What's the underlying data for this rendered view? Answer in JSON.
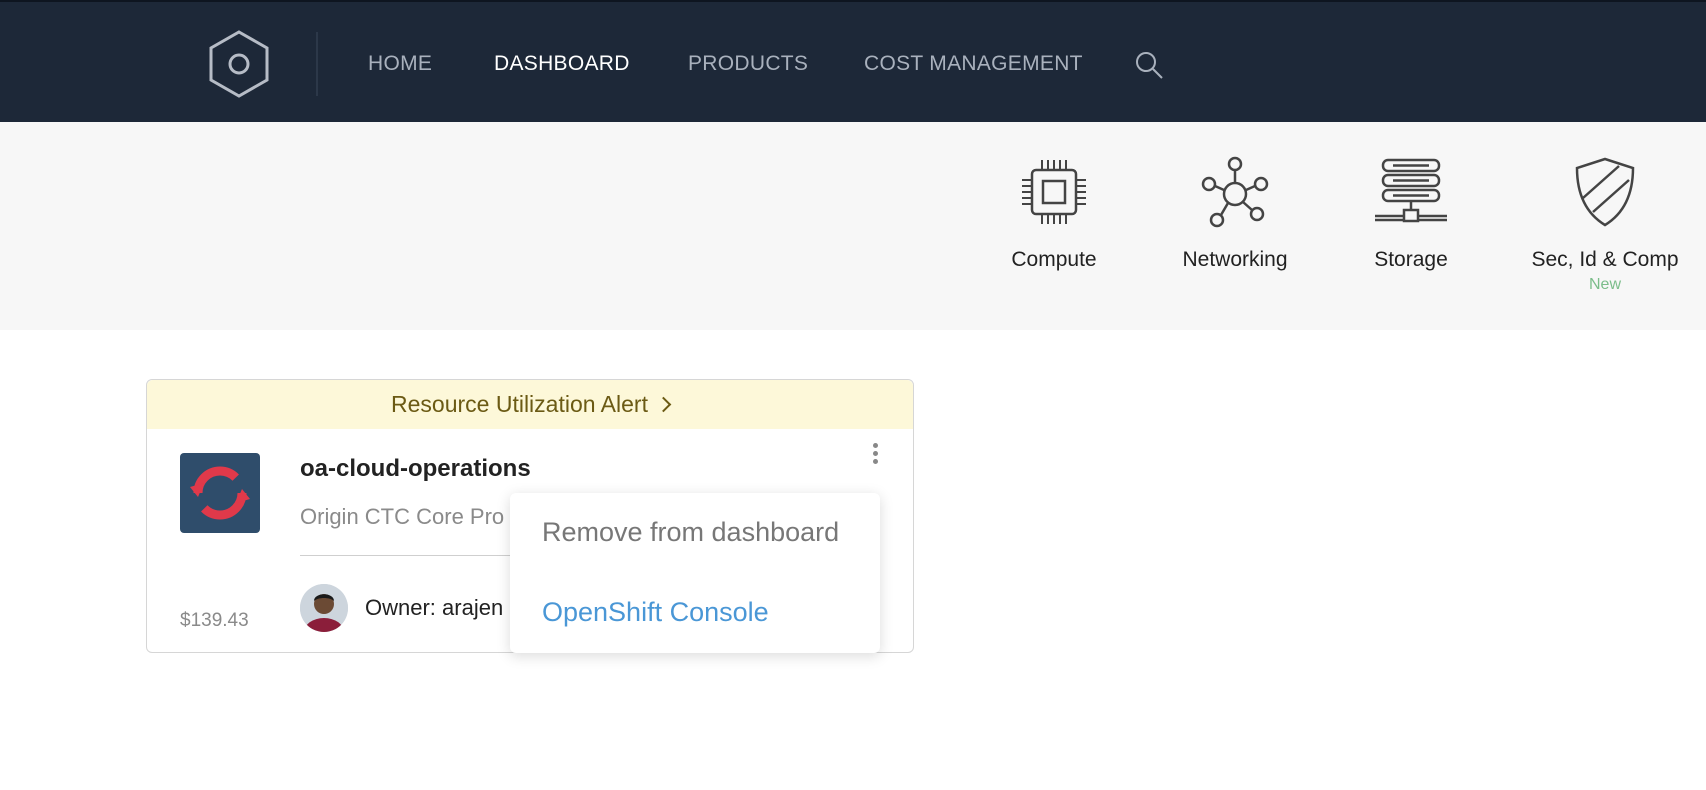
{
  "nav": {
    "items": [
      {
        "label": "HOME",
        "active": false
      },
      {
        "label": "DASHBOARD",
        "active": true
      },
      {
        "label": "PRODUCTS",
        "active": false
      },
      {
        "label": "COST MANAGEMENT",
        "active": false
      }
    ],
    "logo_icon": "hexagon-logo-icon",
    "search_icon": "search-icon"
  },
  "categories": [
    {
      "label": "Compute",
      "icon": "cpu-chip-icon",
      "badge": ""
    },
    {
      "label": "Networking",
      "icon": "network-nodes-icon",
      "badge": ""
    },
    {
      "label": "Storage",
      "icon": "server-storage-icon",
      "badge": ""
    },
    {
      "label": "Sec, Id & Comp",
      "icon": "shield-icon",
      "badge": "New"
    }
  ],
  "card": {
    "alert": "Resource Utilization Alert",
    "project_name": "oa-cloud-operations",
    "description": "Origin CTC Core Pro",
    "cost": "$139.43",
    "owner": "Owner: arajen"
  },
  "menu": {
    "remove_label": "Remove from dashboard",
    "console_label": "OpenShift Console"
  },
  "colors": {
    "nav_bg": "#1d2838",
    "alert_bg": "#fdf8d9",
    "link": "#4a97d6",
    "badge": "#7bbd8a",
    "project_logo_bg": "#2f4d6b",
    "project_logo_ring": "#e0394a"
  }
}
